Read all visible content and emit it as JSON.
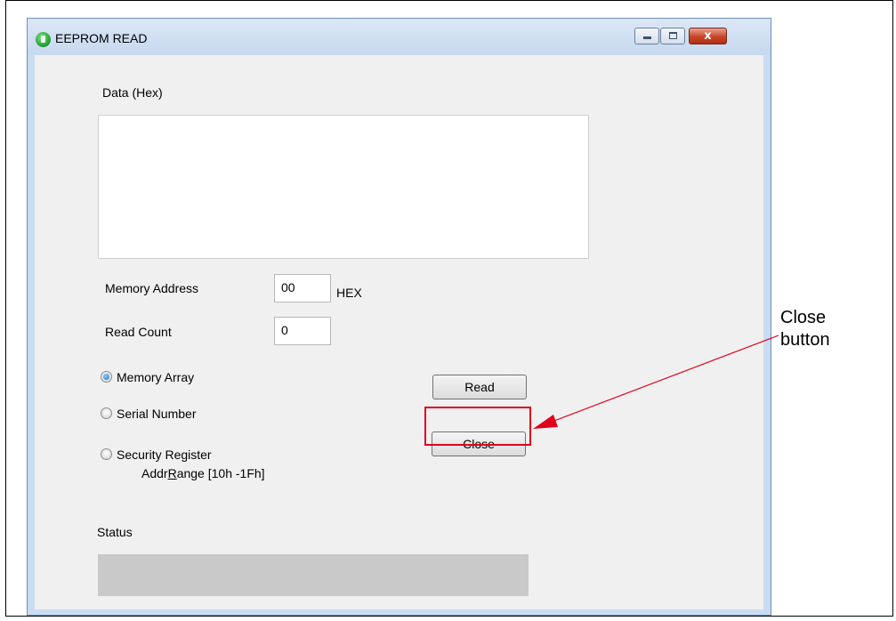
{
  "window": {
    "title": "EEPROM READ"
  },
  "titlebar_buttons": {
    "close_glyph": "x"
  },
  "form": {
    "data_label": "Data (Hex)",
    "memory_address_label": "Memory Address",
    "memory_address_value": "00",
    "hex_suffix": "HEX",
    "read_count_label": "Read Count",
    "read_count_value": "0",
    "radios": [
      {
        "label": "Memory Array",
        "checked": true
      },
      {
        "label": "Serial Number",
        "checked": false
      },
      {
        "label": "Security Register",
        "checked": false
      }
    ],
    "addr_range_prefix": "Addr",
    "addr_range_underlined": "R",
    "addr_range_suffix": "ange [10h -1Fh]",
    "status_label": "Status"
  },
  "buttons": {
    "read_label": "Read",
    "close_label": "Close"
  },
  "annotation": {
    "line1": "Close",
    "line2": "button",
    "color": "#e0001b"
  }
}
